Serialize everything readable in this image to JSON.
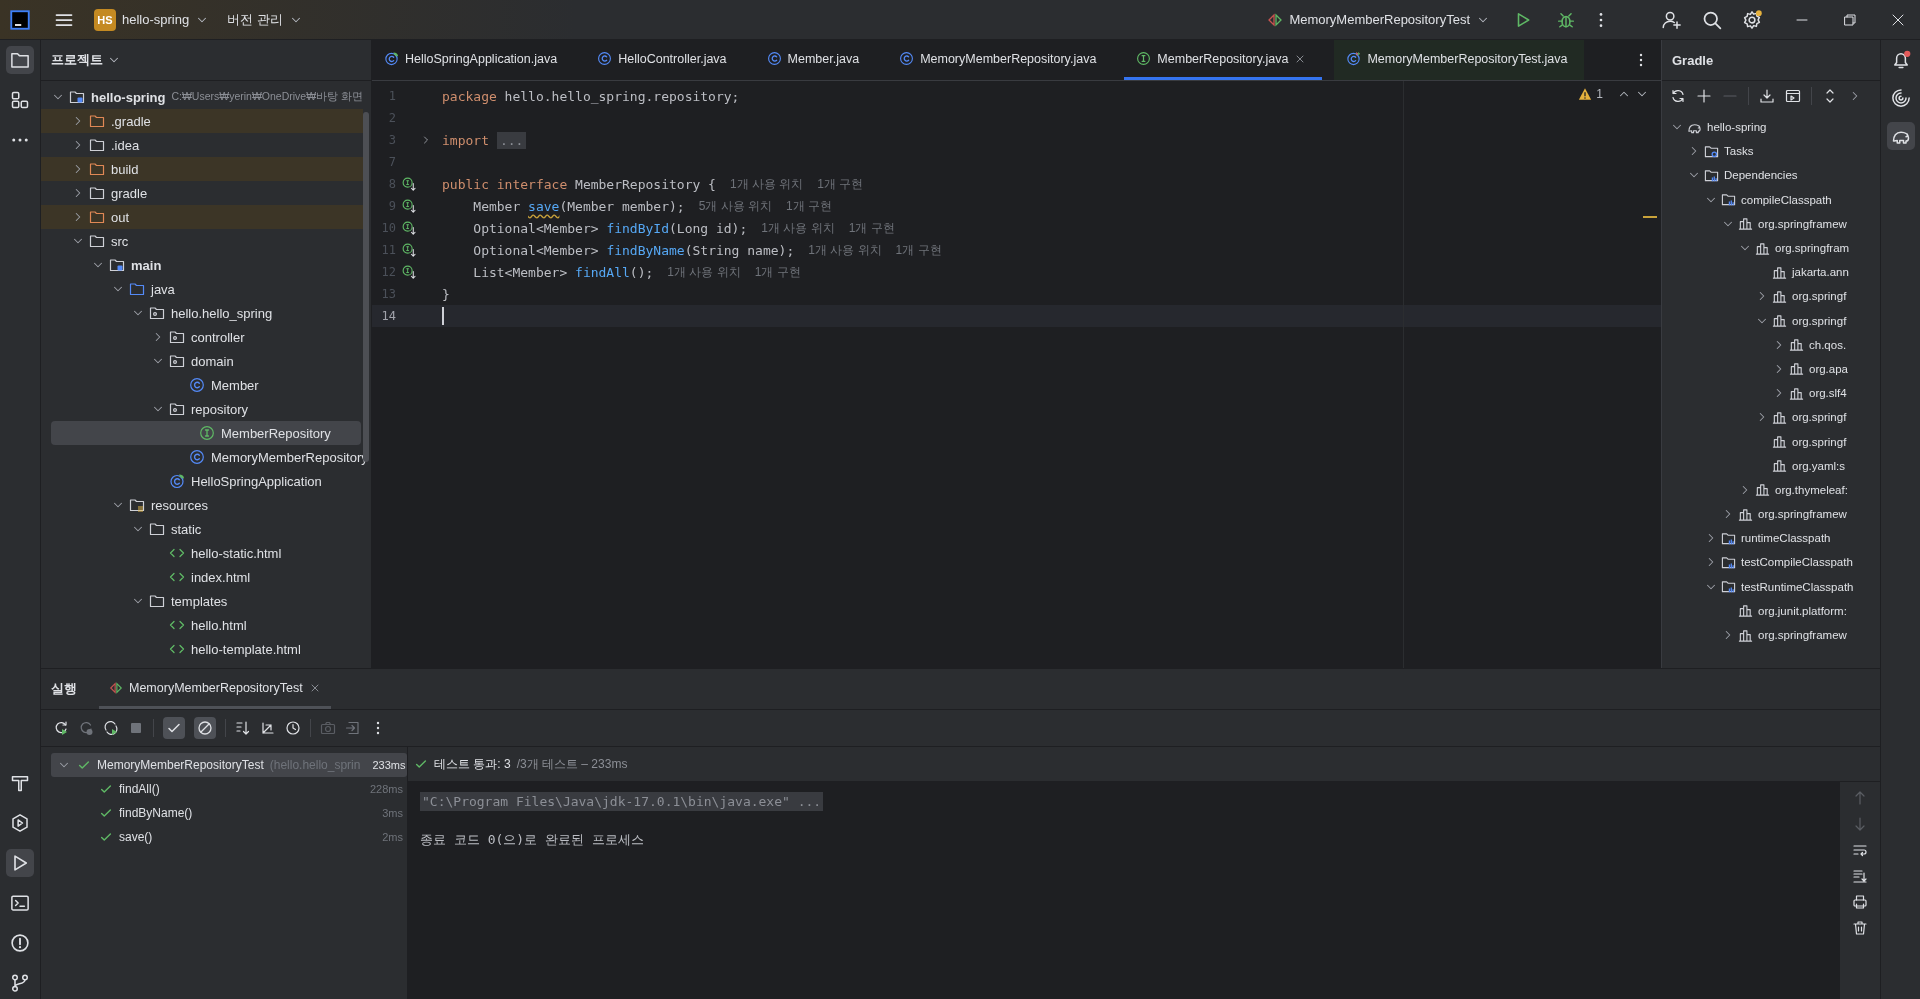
{
  "title_bar": {
    "project_badge": "HS",
    "project": "hello-spring",
    "vcs": "버전 관리",
    "run_config": "MemoryMemberRepositoryTest"
  },
  "project_panel": {
    "title": "프로젝트",
    "tree": [
      {
        "label": "hello-spring",
        "path": "C:₩Users₩yerin₩OneDrive₩바탕 화면",
        "kind": "module",
        "expanded": true,
        "selected": false,
        "children": [
          {
            "label": ".gradle",
            "kind": "folder",
            "excluded": true,
            "expanded": false,
            "selected": false
          },
          {
            "label": ".idea",
            "kind": "folder",
            "excluded": false,
            "expanded": false,
            "selected": false
          },
          {
            "label": "build",
            "kind": "folder",
            "excluded": true,
            "expanded": false,
            "selected": false
          },
          {
            "label": "gradle",
            "kind": "folder",
            "excluded": false,
            "expanded": false,
            "selected": false
          },
          {
            "label": "out",
            "kind": "folder",
            "excluded": true,
            "expanded": false,
            "selected": false
          },
          {
            "label": "src",
            "kind": "folder",
            "excluded": false,
            "expanded": true,
            "selected": false,
            "children": [
              {
                "label": "main",
                "kind": "source-set",
                "expanded": true,
                "selected": false,
                "children": [
                  {
                    "label": "java",
                    "kind": "source-root",
                    "expanded": true,
                    "selected": false,
                    "children": [
                      {
                        "label": "hello.hello_spring",
                        "kind": "package",
                        "expanded": true,
                        "selected": false,
                        "children": [
                          {
                            "label": "controller",
                            "kind": "package",
                            "expanded": false,
                            "selected": false
                          },
                          {
                            "label": "domain",
                            "kind": "package",
                            "expanded": true,
                            "selected": false,
                            "children": [
                              {
                                "label": "Member",
                                "kind": "class",
                                "selected": false
                              }
                            ]
                          },
                          {
                            "label": "repository",
                            "kind": "package",
                            "expanded": true,
                            "selected": false,
                            "children": [
                              {
                                "label": "MemberRepository",
                                "kind": "interface",
                                "selected": true
                              },
                              {
                                "label": "MemoryMemberRepository",
                                "kind": "class",
                                "selected": false
                              }
                            ]
                          },
                          {
                            "label": "HelloSpringApplication",
                            "kind": "app",
                            "selected": false
                          }
                        ]
                      }
                    ]
                  },
                  {
                    "label": "resources",
                    "kind": "resources",
                    "expanded": true,
                    "selected": false,
                    "children": [
                      {
                        "label": "static",
                        "kind": "folder",
                        "expanded": true,
                        "selected": false,
                        "children": [
                          {
                            "label": "hello-static.html",
                            "kind": "html",
                            "selected": false
                          },
                          {
                            "label": "index.html",
                            "kind": "html",
                            "selected": false
                          }
                        ]
                      },
                      {
                        "label": "templates",
                        "kind": "folder",
                        "expanded": true,
                        "selected": false,
                        "children": [
                          {
                            "label": "hello.html",
                            "kind": "html",
                            "selected": false
                          },
                          {
                            "label": "hello-template.html",
                            "kind": "html",
                            "selected": false
                          }
                        ]
                      }
                    ]
                  }
                ]
              }
            ]
          }
        ]
      }
    ]
  },
  "editor": {
    "tabs": [
      {
        "label": "HelloSpringApplication.java",
        "kind": "app",
        "selected": false
      },
      {
        "label": "HelloController.java",
        "kind": "class",
        "selected": false
      },
      {
        "label": "Member.java",
        "kind": "class",
        "selected": false
      },
      {
        "label": "MemoryMemberRepository.java",
        "kind": "class",
        "selected": false
      },
      {
        "label": "MemberRepository.java",
        "kind": "interface",
        "selected": true
      },
      {
        "label": "MemoryMemberRepositoryTest.java",
        "kind": "test",
        "selected": false
      }
    ],
    "warnings": "1",
    "lines": [
      {
        "number": "1",
        "marker": false,
        "foldable": false,
        "current": false,
        "code": [
          {
            "kind": "keyword",
            "text": "package"
          },
          {
            "kind": "plain",
            "text": " hello.hello_spring.repository;"
          }
        ]
      },
      {
        "number": "2",
        "marker": false,
        "foldable": false,
        "current": false
      },
      {
        "number": "3",
        "marker": false,
        "foldable": true,
        "current": false,
        "code": [
          {
            "kind": "keyword",
            "text": "import"
          },
          {
            "kind": "folded",
            "text": "..."
          }
        ]
      },
      {
        "number": "7",
        "marker": false,
        "foldable": false,
        "current": false
      },
      {
        "number": "8",
        "marker": true,
        "foldable": false,
        "current": false,
        "code": [
          {
            "kind": "keyword",
            "text": "public interface"
          },
          {
            "kind": "plain",
            "text": " MemberRepository {"
          }
        ],
        "hints": [
          "1개 사용 위치",
          "1개 구현"
        ]
      },
      {
        "number": "9",
        "marker": true,
        "foldable": false,
        "current": false,
        "code": [
          {
            "kind": "plain",
            "text": "    Member "
          },
          {
            "kind": "method-warning",
            "text": "save"
          },
          {
            "kind": "plain",
            "text": "(Member member);"
          }
        ],
        "hints": [
          "5개 사용 위치",
          "1개 구현"
        ]
      },
      {
        "number": "10",
        "marker": true,
        "foldable": false,
        "current": false,
        "code": [
          {
            "kind": "plain",
            "text": "    Optional<Member> "
          },
          {
            "kind": "method",
            "text": "findById"
          },
          {
            "kind": "plain",
            "text": "(Long id);"
          }
        ],
        "hints": [
          "1개 사용 위치",
          "1개 구현"
        ]
      },
      {
        "number": "11",
        "marker": true,
        "foldable": false,
        "current": false,
        "code": [
          {
            "kind": "plain",
            "text": "    Optional<Member> "
          },
          {
            "kind": "method",
            "text": "findByName"
          },
          {
            "kind": "plain",
            "text": "(String name);"
          }
        ],
        "hints": [
          "1개 사용 위치",
          "1개 구현"
        ]
      },
      {
        "number": "12",
        "marker": true,
        "foldable": false,
        "current": false,
        "code": [
          {
            "kind": "plain",
            "text": "    List<Member> "
          },
          {
            "kind": "method",
            "text": "findAll"
          },
          {
            "kind": "plain",
            "text": "();"
          }
        ],
        "hints": [
          "1개 사용 위치",
          "1개 구현"
        ]
      },
      {
        "number": "13",
        "marker": false,
        "foldable": false,
        "current": false,
        "code": [
          {
            "kind": "plain",
            "text": "}"
          }
        ]
      },
      {
        "number": "14",
        "marker": false,
        "foldable": false,
        "current": true
      }
    ]
  },
  "gradle_panel": {
    "title": "Gradle",
    "tree": [
      {
        "label": "hello-spring",
        "kind": "project",
        "expanded": true,
        "children": [
          {
            "label": "Tasks",
            "kind": "tasks",
            "expanded": false
          },
          {
            "label": "Dependencies",
            "kind": "config",
            "expanded": true,
            "children": [
              {
                "label": "compileClasspath",
                "kind": "config",
                "expanded": true,
                "children": [
                  {
                    "label": "org.springframew",
                    "kind": "library",
                    "expanded": true,
                    "children": [
                      {
                        "label": "org.springfram",
                        "kind": "library",
                        "expanded": true,
                        "children": [
                          {
                            "label": "jakarta.ann",
                            "kind": "library"
                          },
                          {
                            "label": "org.springf",
                            "kind": "library",
                            "expanded": false
                          },
                          {
                            "label": "org.springf",
                            "kind": "library",
                            "expanded": true,
                            "children": [
                              {
                                "label": "ch.qos.",
                                "kind": "library",
                                "expanded": false
                              },
                              {
                                "label": "org.apa",
                                "kind": "library",
                                "expanded": false
                              },
                              {
                                "label": "org.slf4",
                                "kind": "library",
                                "expanded": false
                              }
                            ]
                          },
                          {
                            "label": "org.springf",
                            "kind": "library",
                            "expanded": false
                          },
                          {
                            "label": "org.springf",
                            "kind": "library"
                          },
                          {
                            "label": "org.yaml:s",
                            "kind": "library"
                          }
                        ]
                      },
                      {
                        "label": "org.thymeleaf:",
                        "kind": "library",
                        "expanded": false
                      }
                    ]
                  },
                  {
                    "label": "org.springframew",
                    "kind": "library",
                    "expanded": false
                  }
                ]
              },
              {
                "label": "runtimeClasspath",
                "kind": "config",
                "expanded": false
              },
              {
                "label": "testCompileClasspath",
                "kind": "config",
                "expanded": false
              },
              {
                "label": "testRuntimeClasspath",
                "kind": "config",
                "expanded": true,
                "children": [
                  {
                    "label": "org.junit.platform:",
                    "kind": "library"
                  },
                  {
                    "label": "org.springframew",
                    "kind": "library",
                    "expanded": false
                  }
                ]
              }
            ]
          }
        ]
      }
    ]
  },
  "run_panel": {
    "title": "실행",
    "tab": "MemoryMemberRepositoryTest",
    "show_passed": true,
    "show_ignored": true,
    "tests": [
      {
        "name": "MemoryMemberRepositoryTest",
        "detail": "(hello.hello_sprin",
        "time": "233ms",
        "passed": true,
        "expanded": true,
        "selected": true,
        "children": [
          {
            "name": "findAll()",
            "time": "228ms",
            "passed": true,
            "selected": false
          },
          {
            "name": "findByName()",
            "time": "3ms",
            "passed": true,
            "selected": false
          },
          {
            "name": "save()",
            "time": "2ms",
            "passed": true,
            "selected": false
          }
        ]
      }
    ],
    "status": {
      "passed": "테스트 통과: 3",
      "summary": "/3개 테스트 – 233ms"
    },
    "console": [
      {
        "kind": "command",
        "text": "\"C:\\Program Files\\Java\\jdk-17.0.1\\bin\\java.exe\" ..."
      },
      {
        "kind": "output",
        "text": "종료 코드 0(으)로 완료된 프로세스"
      }
    ]
  }
}
